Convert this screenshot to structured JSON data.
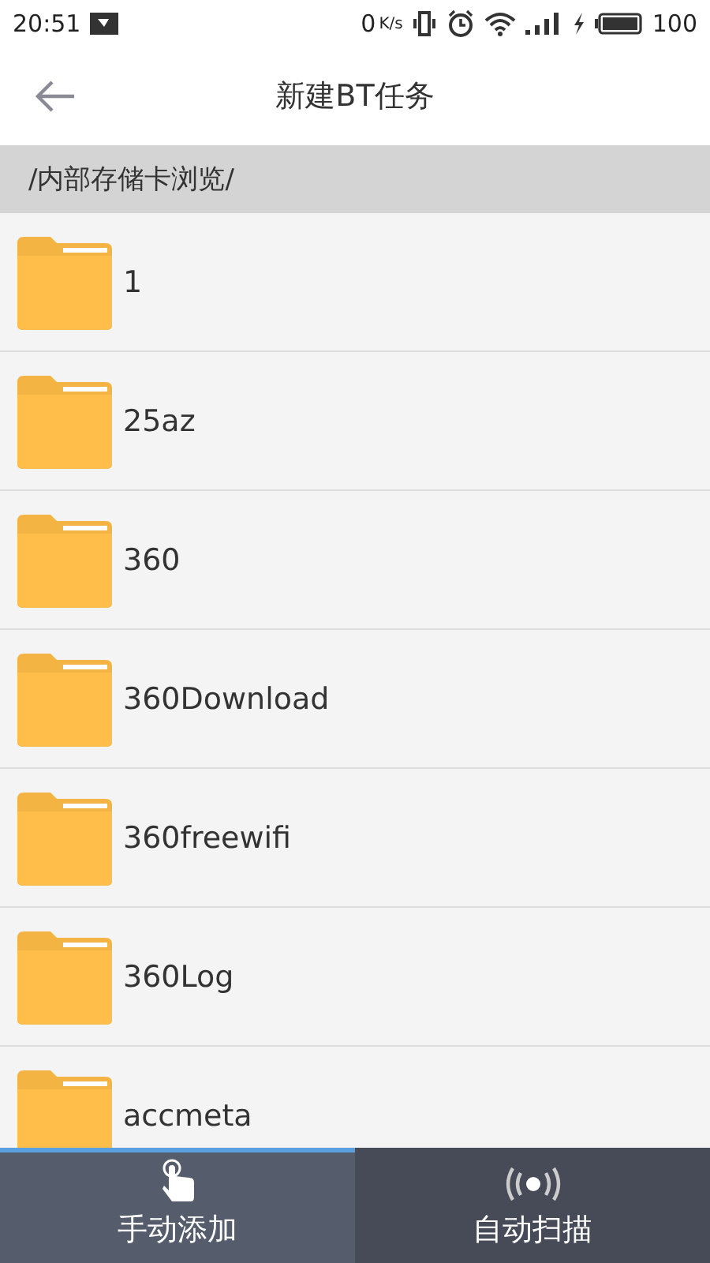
{
  "status_bar": {
    "time": "20:51",
    "speed": "0",
    "speed_unit": "K/s",
    "battery": "100"
  },
  "app_bar": {
    "title": "新建BT任务"
  },
  "path": "/内部存储卡浏览/",
  "folders": [
    {
      "name": "1"
    },
    {
      "name": "25az"
    },
    {
      "name": "360"
    },
    {
      "name": "360Download"
    },
    {
      "name": "360freewifi"
    },
    {
      "name": "360Log"
    },
    {
      "name": "accmeta"
    }
  ],
  "bottom_tabs": [
    {
      "label": "手动添加",
      "kind": "manual",
      "selected": true
    },
    {
      "label": "自动扫描",
      "kind": "scan",
      "selected": false
    }
  ]
}
